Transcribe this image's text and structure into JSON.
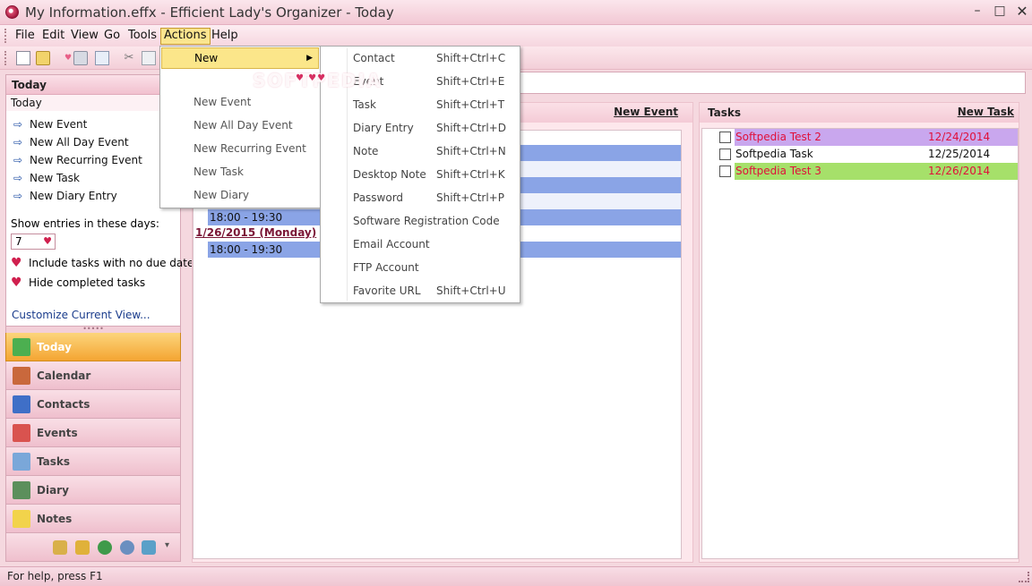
{
  "window": {
    "title": "My Information.effx - Efficient Lady's Organizer - Today",
    "min_glyph": "–",
    "max_glyph": "□",
    "close_glyph": "✕"
  },
  "menubar": {
    "items": [
      "File",
      "Edit",
      "View",
      "Go",
      "Tools",
      "Actions",
      "Help"
    ]
  },
  "actions_menu": {
    "items": [
      {
        "label": "New",
        "has_submenu": true
      },
      {
        "label": "New Event"
      },
      {
        "label": "New All Day Event"
      },
      {
        "label": "New Recurring Event"
      },
      {
        "label": "New Task"
      },
      {
        "label": "New Diary"
      }
    ],
    "submenu_arrow": "▶"
  },
  "new_submenu": {
    "items": [
      {
        "label": "Contact",
        "shortcut": "Shift+Ctrl+C"
      },
      {
        "label": "Event",
        "shortcut": "Shift+Ctrl+E"
      },
      {
        "label": "Task",
        "shortcut": "Shift+Ctrl+T"
      },
      {
        "label": "Diary Entry",
        "shortcut": "Shift+Ctrl+D"
      },
      {
        "label": "Note",
        "shortcut": "Shift+Ctrl+N"
      },
      {
        "label": "Desktop Note",
        "shortcut": "Shift+Ctrl+K"
      },
      {
        "label": "Password",
        "shortcut": "Shift+Ctrl+P"
      },
      {
        "label": "Software Registration Code",
        "shortcut": ""
      },
      {
        "label": "Email Account",
        "shortcut": ""
      },
      {
        "label": "FTP Account",
        "shortcut": ""
      },
      {
        "label": "Favorite URL",
        "shortcut": "Shift+Ctrl+U"
      }
    ]
  },
  "watermark": {
    "text": "SOFTPEDIA",
    "hearts": "♥ ♥♥"
  },
  "left_panel": {
    "header": "Today",
    "subheader": "Today",
    "links": [
      "New Event",
      "New All Day Event",
      "New Recurring Event",
      "New Task",
      "New Diary Entry"
    ],
    "arrow_glyph": "⇨",
    "show_entries_label": "Show entries in these days:",
    "days_value": "7",
    "heart_glyph": "♥",
    "options": [
      "Include tasks with no due date",
      "Hide completed tasks"
    ],
    "customize_link": "Customize Current View...",
    "splitter_glyph": "•••••"
  },
  "navigation": {
    "buttons": [
      {
        "label": "Today",
        "icon": "home-icon",
        "color": "#4caf50",
        "active": true
      },
      {
        "label": "Calendar",
        "icon": "calendar-icon",
        "color": "#c9683c",
        "active": false
      },
      {
        "label": "Contacts",
        "icon": "contacts-icon",
        "color": "#3f6fc7",
        "active": false
      },
      {
        "label": "Events",
        "icon": "events-icon",
        "color": "#d9534f",
        "active": false
      },
      {
        "label": "Tasks",
        "icon": "tasks-icon",
        "color": "#7aa7d9",
        "active": false
      },
      {
        "label": "Diary",
        "icon": "diary-icon",
        "color": "#5c8f5c",
        "active": false
      },
      {
        "label": "Notes",
        "icon": "notes-icon",
        "color": "#f2d34b",
        "active": false
      }
    ],
    "footer_icons": [
      {
        "name": "clipboard-icon",
        "color": "#d9b04a"
      },
      {
        "name": "key-icon",
        "color": "#e0b13a"
      },
      {
        "name": "globe-icon",
        "color": "#3f9a4a"
      },
      {
        "name": "magnifier-icon",
        "color": "#6a8fc0"
      },
      {
        "name": "ftp-icon",
        "color": "#5aa0c8"
      }
    ],
    "footer_dropdown_glyph": "▾"
  },
  "events_panel": {
    "new_event_link": "New Event",
    "rows": [
      {
        "type": "event",
        "text": ""
      },
      {
        "type": "alt",
        "text": ""
      },
      {
        "type": "event",
        "text": ""
      },
      {
        "type": "alt",
        "text": ""
      },
      {
        "type": "event",
        "text": "18:00 - 19:30"
      },
      {
        "type": "date",
        "text": "1/26/2015 (Monday)"
      },
      {
        "type": "event",
        "text": "18:00 - 19:30"
      }
    ]
  },
  "tasks_panel": {
    "title": "Tasks",
    "new_task_link": "New Task",
    "tasks": [
      {
        "name": "Softpedia Test 2",
        "date": "12/24/2014",
        "bg": "#c9a7ee",
        "color": "#e0103a"
      },
      {
        "name": "Softpedia Task",
        "date": "12/25/2014",
        "bg": "#ffffff",
        "color": "#111111"
      },
      {
        "name": "Softpedia Test 3",
        "date": "12/26/2014",
        "bg": "#a6e06a",
        "color": "#e0103a"
      }
    ]
  },
  "statusbar": {
    "text": "For help, press F1"
  }
}
